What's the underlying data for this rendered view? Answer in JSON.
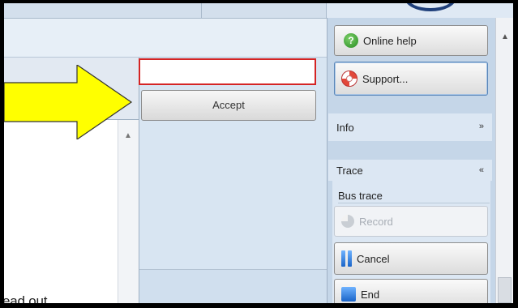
{
  "left_panel": {
    "readout_text": "ead out.",
    "scroll_up": "▲"
  },
  "main": {
    "accept_label": "Accept",
    "input_value": ""
  },
  "sidebar": {
    "online_help_label": "Online help",
    "support_label": "Support...",
    "info": {
      "title": "Info",
      "chevron": "»"
    },
    "trace": {
      "title": "Trace",
      "chevron": "«",
      "bus_trace_label": "Bus trace",
      "record_label": "Record",
      "cancel_label": "Cancel",
      "end_label": "End"
    },
    "help_icon_glyph": "?",
    "scroll_up": "▲"
  },
  "icons": {
    "arrow": "yellow-pointer-arrow",
    "help": "help-icon",
    "support": "lifebuoy-icon",
    "record": "record-icon",
    "cancel": "pause-icon",
    "end": "stop-icon"
  },
  "colors": {
    "arrow_fill": "#ffff00",
    "highlight_border": "#d42424",
    "panel_bg": "#d8e5f2",
    "sidebar_bg": "#c5d6e8"
  }
}
